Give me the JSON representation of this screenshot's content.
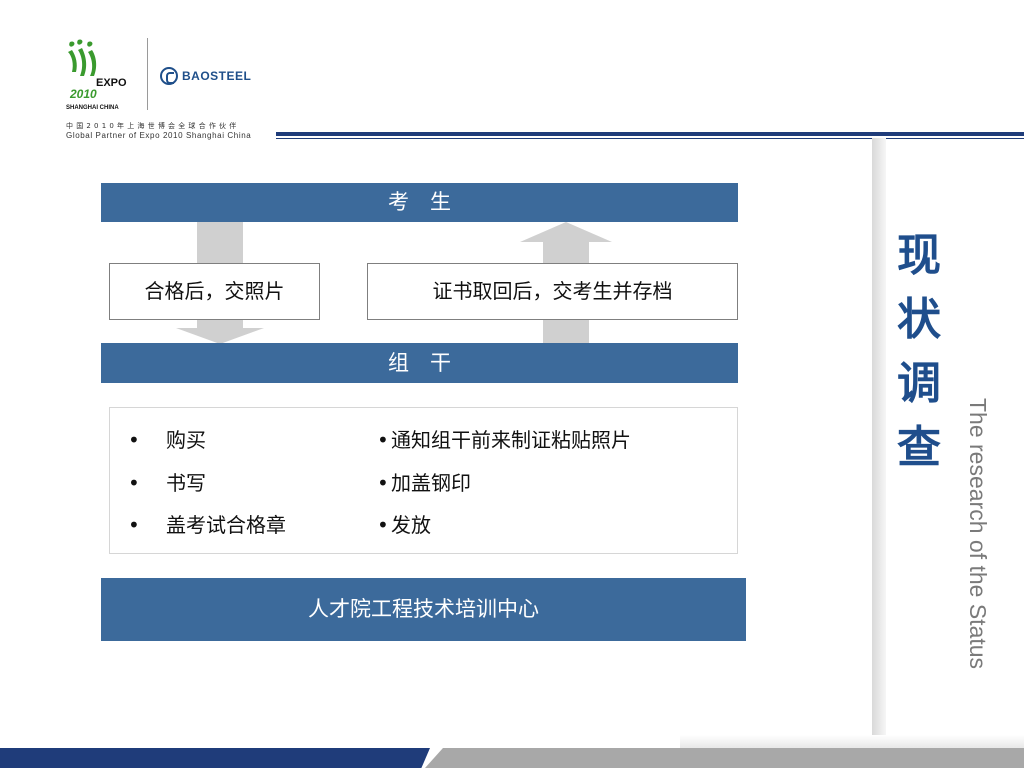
{
  "header": {
    "expo_logo_text": "EXPO 2010 SHANGHAI CHINA",
    "baosteel_name": "BAOSTEEL",
    "partner_cn": "中国2010年上海世博会全球合作伙伴",
    "partner_en": "Global Partner of Expo 2010 Shanghai China"
  },
  "side": {
    "title_chars": [
      "现",
      "状",
      "调",
      "查"
    ],
    "subtitle": "The research of the Status"
  },
  "diagram": {
    "top_bar": "考　生",
    "left_box": "合格后，交照片",
    "right_box": "证书取回后，交考生并存档",
    "mid_bar": "组　干",
    "left_list": [
      "购买",
      "书写",
      "盖考试合格章"
    ],
    "right_list": [
      "通知组干前来制证粘贴照片",
      "加盖钢印",
      "发放"
    ],
    "bottom_bar": "人才院工程技术培训中心"
  },
  "colors": {
    "bar_blue": "#3c6a9b",
    "title_blue": "#1f4e8c",
    "navy": "#1f3c7a"
  }
}
